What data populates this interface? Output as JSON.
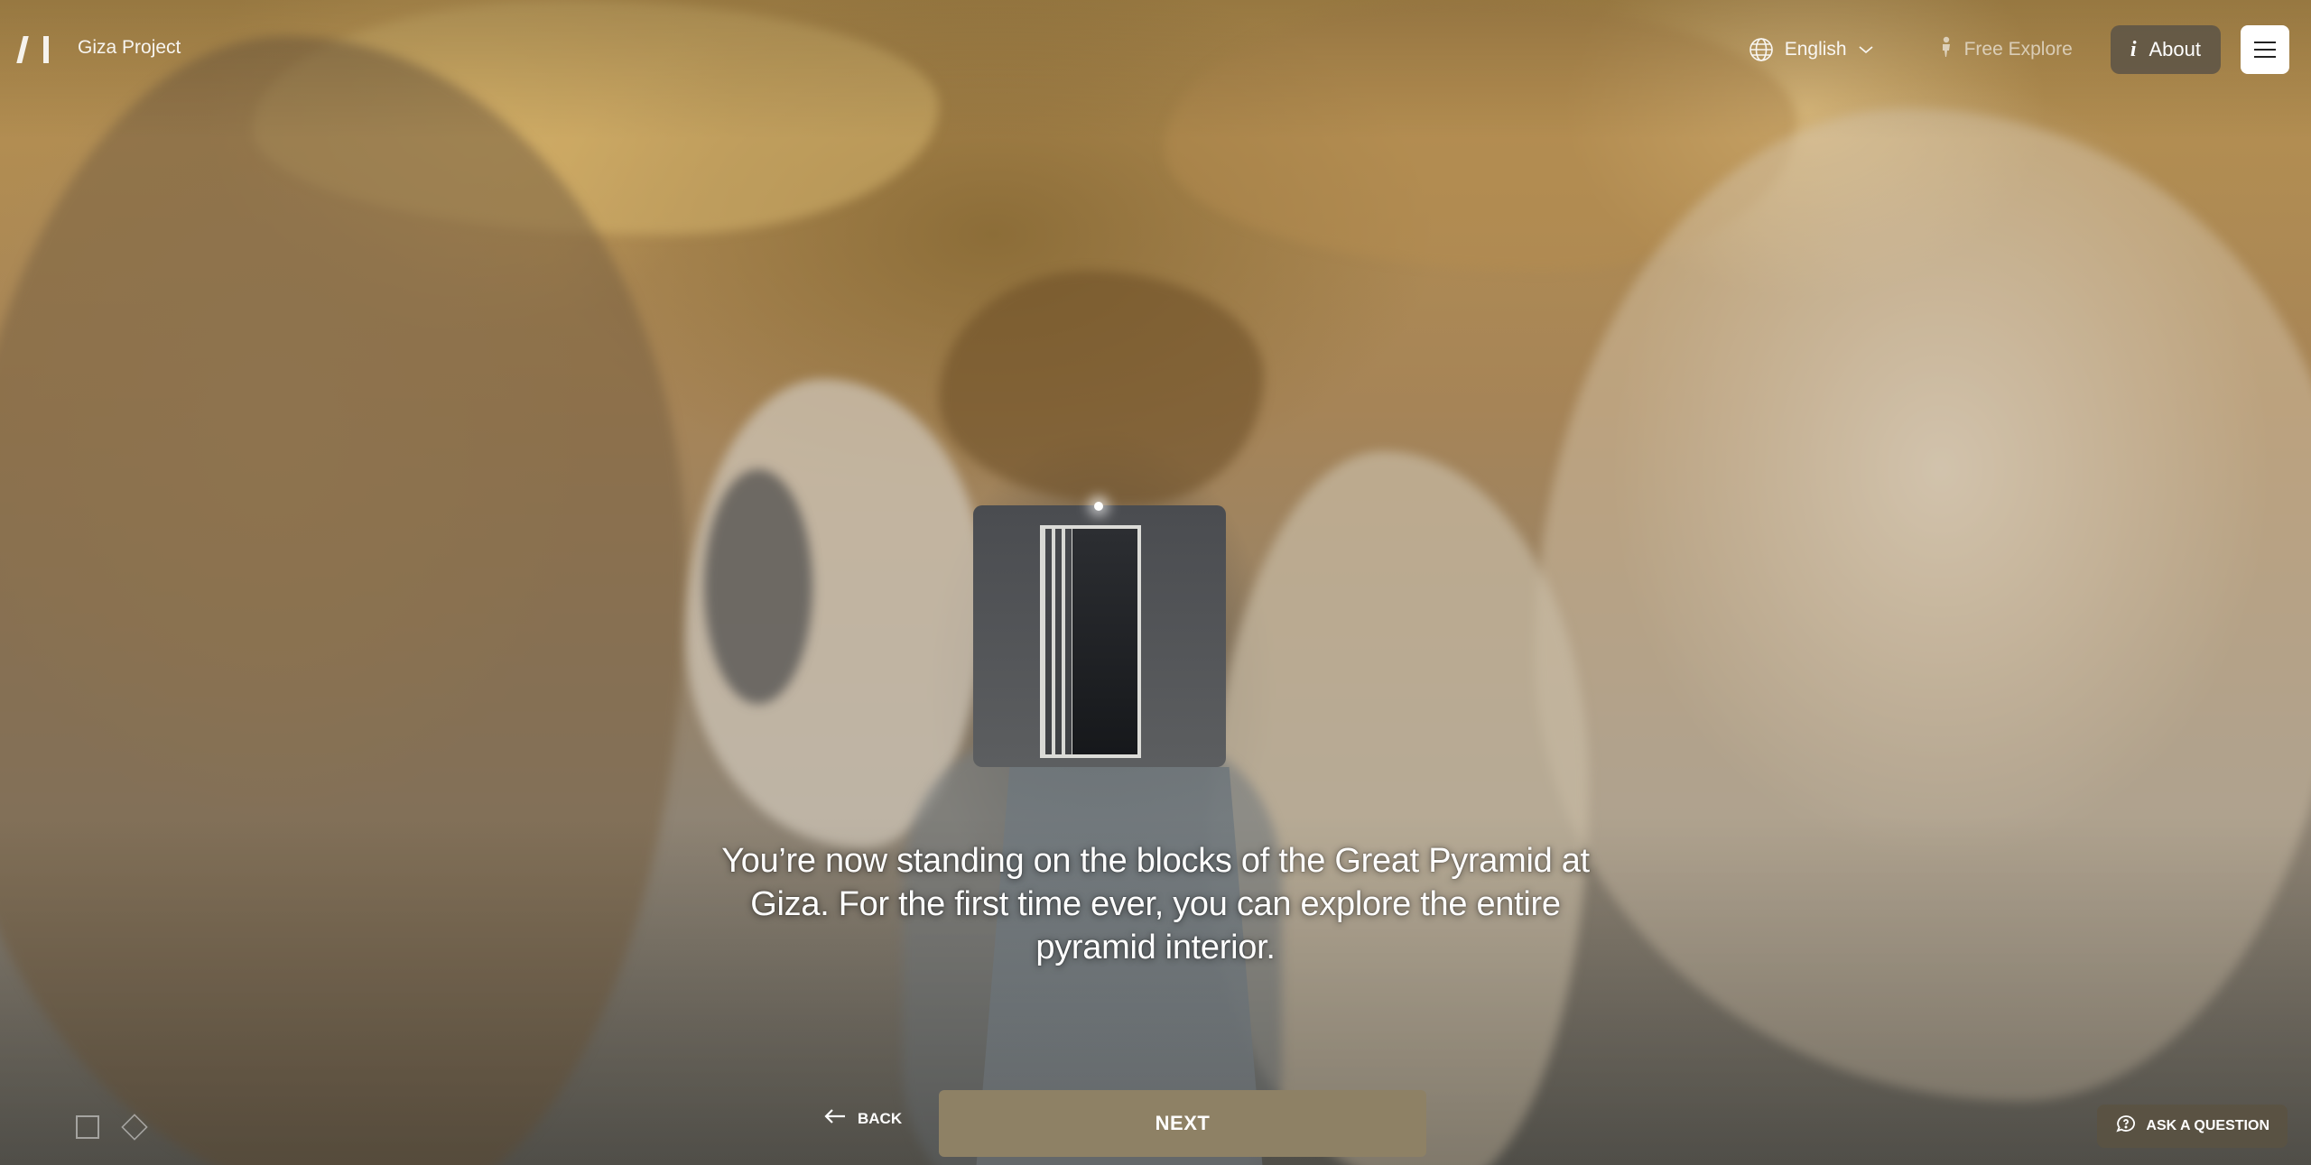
{
  "header": {
    "brand": "Giza Project",
    "language": {
      "label": "English",
      "icon": "globe-icon"
    },
    "free_explore": {
      "label": "Free Explore",
      "icon": "person-icon"
    },
    "about": {
      "label": "About",
      "icon": "info-icon"
    },
    "menu": {
      "icon": "hamburger-icon"
    }
  },
  "caption": {
    "text": "You’re now standing on the blocks of the Great Pyramid at Giza. For the first time ever, you can explore the entire pyramid interior."
  },
  "footer": {
    "back_label": "BACK",
    "next_label": "NEXT",
    "ask_label": "ASK A QUESTION"
  },
  "colors": {
    "next_button": "#8e8165",
    "about_button": "#5c5446",
    "ask_button": "#5a5242"
  }
}
